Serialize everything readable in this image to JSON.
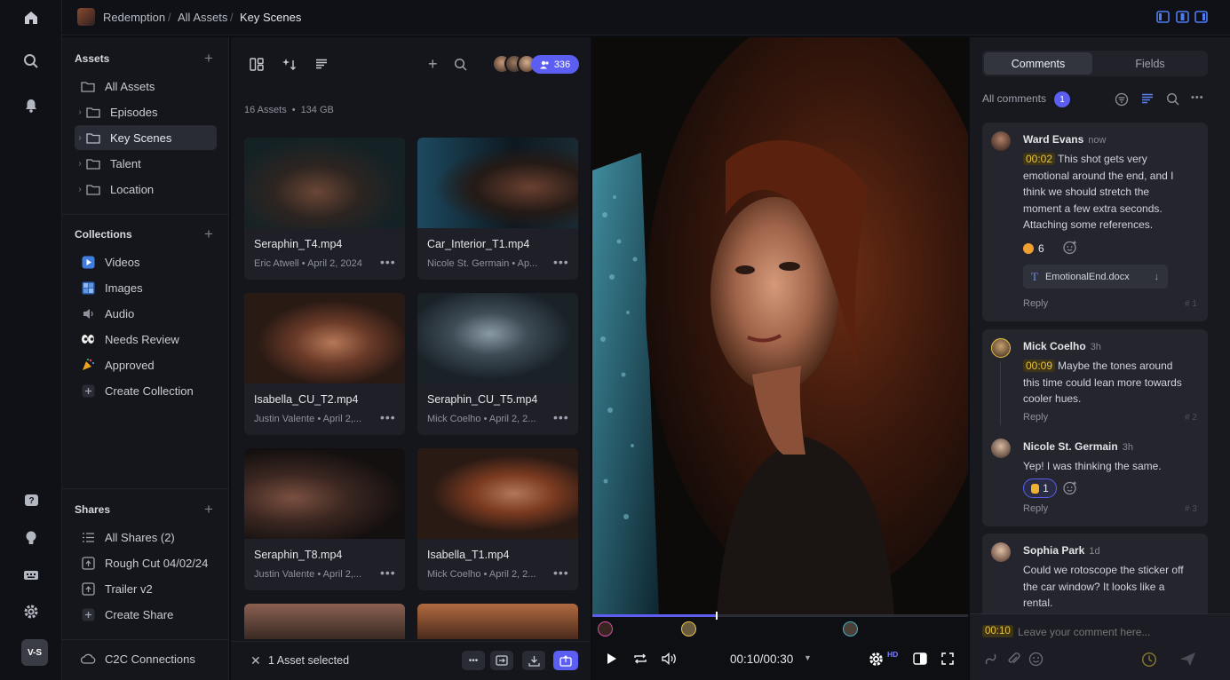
{
  "breadcrumb": {
    "project": "Redemption",
    "parent": "All Assets",
    "current": "Key Scenes"
  },
  "sidebar": {
    "assets_title": "Assets",
    "assets": [
      {
        "label": "All Assets"
      },
      {
        "label": "Episodes"
      },
      {
        "label": "Key Scenes"
      },
      {
        "label": "Talent"
      },
      {
        "label": "Location"
      }
    ],
    "collections_title": "Collections",
    "collections": [
      {
        "label": "Videos"
      },
      {
        "label": "Images"
      },
      {
        "label": "Audio"
      },
      {
        "label": "Needs Review"
      },
      {
        "label": "Approved"
      },
      {
        "label": "Create Collection"
      }
    ],
    "shares_title": "Shares",
    "shares": [
      {
        "label": "All Shares (2)"
      },
      {
        "label": "Rough Cut 04/02/24"
      },
      {
        "label": "Trailer v2"
      },
      {
        "label": "Create Share"
      }
    ],
    "c2c": "C2C Connections"
  },
  "grid": {
    "viewer_count": "336",
    "asset_count": "16 Assets",
    "asset_size": "134 GB",
    "assets": [
      {
        "name": "Seraphin_T4.mp4",
        "meta": "Eric Atwell  •  April 2, 2024"
      },
      {
        "name": "Car_Interior_T1.mp4",
        "meta": "Nicole St. Germain  •  Ap..."
      },
      {
        "name": "Isabella_CU_T2.mp4",
        "meta": "Justin Valente  •  April 2,..."
      },
      {
        "name": "Seraphin_CU_T5.mp4",
        "meta": "Mick Coelho  •  April 2, 2..."
      },
      {
        "name": "Seraphin_T8.mp4",
        "meta": "Justin Valente  •  April 2,..."
      },
      {
        "name": "Isabella_T1.mp4",
        "meta": "Mick Coelho  •  April 2, 2..."
      }
    ],
    "selection": "1 Asset selected"
  },
  "player": {
    "timecode": "00:10/00:30",
    "quality_badge": "HD",
    "progress": 0.33
  },
  "comments_panel": {
    "tabs": [
      "Comments",
      "Fields"
    ],
    "filter_label": "All comments",
    "filter_count": "1",
    "comments": [
      {
        "author": "Ward Evans",
        "time": "now",
        "timestamp": "00:02",
        "text": "This shot gets very emotional around the end, and I think we should stretch the moment a few extra seconds. Attaching some references.",
        "reaction_count": "6",
        "attachment": "EmotionalEnd.docx",
        "reply": "Reply",
        "num": "# 1"
      },
      {
        "author": "Mick Coelho",
        "time": "3h",
        "timestamp": "00:09",
        "text": "Maybe the tones around this time could lean more towards cooler hues.",
        "reply": "Reply",
        "num": "# 2"
      },
      {
        "author": "Nicole St. Germain",
        "time": "3h",
        "text": "Yep! I was thinking the same.",
        "reaction_count": "1",
        "reply": "Reply",
        "num": "# 3"
      },
      {
        "author": "Sophia Park",
        "time": "1d",
        "text": "Could we rotoscope the sticker off the car window? It looks like a rental."
      }
    ],
    "input_timestamp": "00:10",
    "input_placeholder": "Leave your comment here..."
  },
  "colors": {
    "accent": "#5b5ef0",
    "timestamp_bg": "#3d3516",
    "timestamp_fg": "#e9c446"
  },
  "logo_text": "V-S"
}
